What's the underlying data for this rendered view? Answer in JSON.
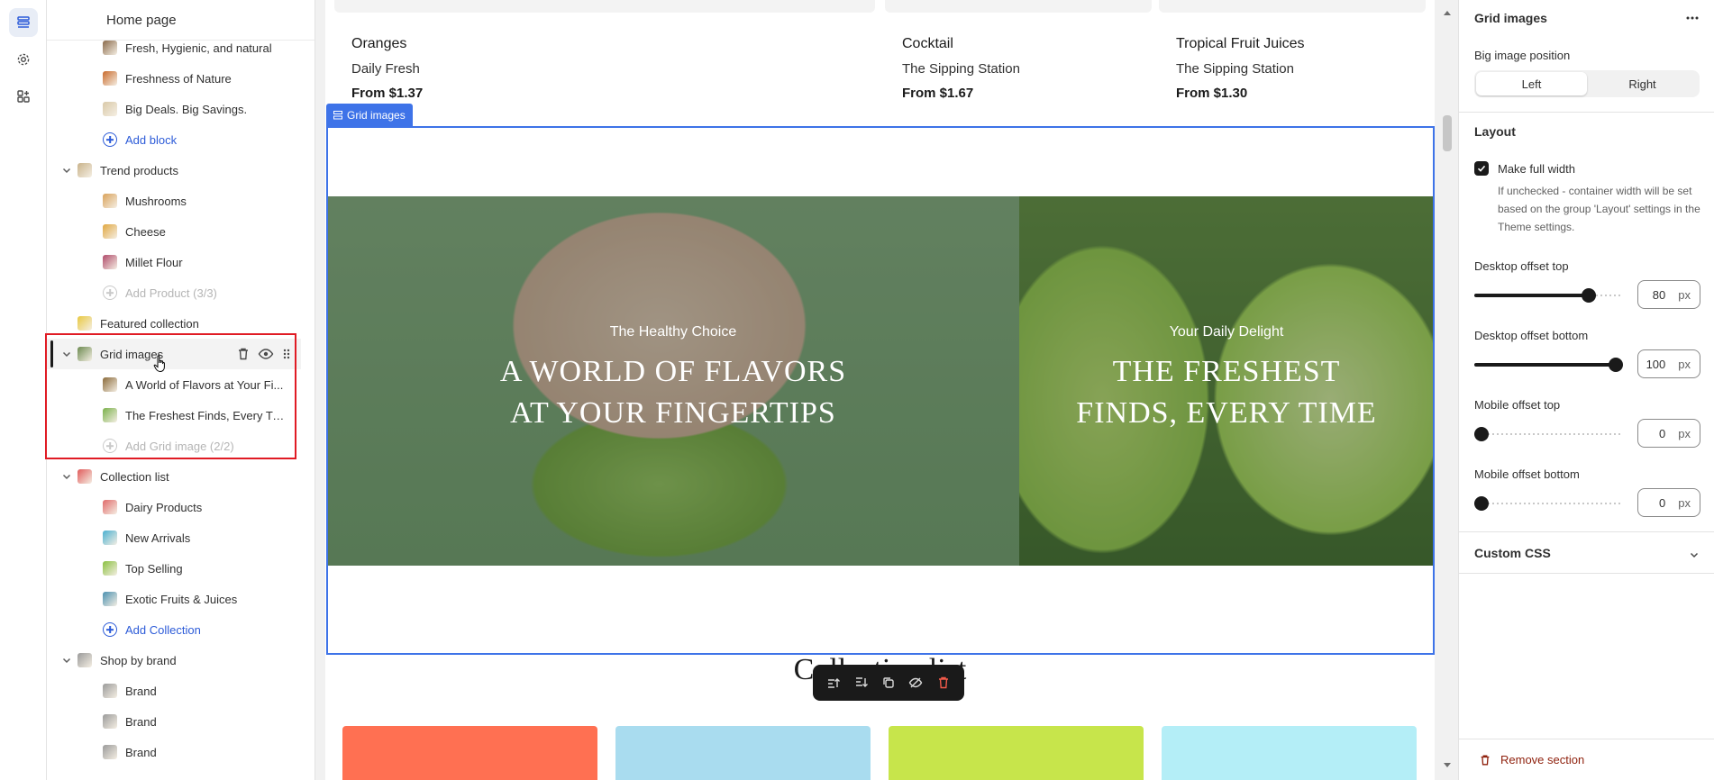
{
  "tree": {
    "title": "Home page",
    "rows": [
      {
        "label": "Fresh, Hygienic, and natural",
        "type": "child"
      },
      {
        "label": "Freshness of Nature",
        "type": "child"
      },
      {
        "label": "Big Deals. Big Savings.",
        "type": "child"
      },
      {
        "label": "Add block",
        "type": "add"
      },
      {
        "label": "Trend products",
        "type": "section"
      },
      {
        "label": "Mushrooms",
        "type": "child"
      },
      {
        "label": "Cheese",
        "type": "child"
      },
      {
        "label": "Millet Flour",
        "type": "child"
      },
      {
        "label": "Add Product (3/3)",
        "type": "add-disabled"
      },
      {
        "label": "Featured collection",
        "type": "section-nochev"
      },
      {
        "label": "Grid images",
        "type": "section-selected"
      },
      {
        "label": "A World of Flavors at Your Fi...",
        "type": "child"
      },
      {
        "label": "The Freshest Finds, Every Time",
        "type": "child"
      },
      {
        "label": "Add Grid image (2/2)",
        "type": "add-disabled"
      },
      {
        "label": "Collection list",
        "type": "section"
      },
      {
        "label": "Dairy Products",
        "type": "child"
      },
      {
        "label": "New Arrivals",
        "type": "child"
      },
      {
        "label": "Top Selling",
        "type": "child"
      },
      {
        "label": "Exotic Fruits & Juices",
        "type": "child"
      },
      {
        "label": "Add Collection",
        "type": "add"
      },
      {
        "label": "Shop by brand",
        "type": "section"
      },
      {
        "label": "Brand",
        "type": "child"
      },
      {
        "label": "Brand",
        "type": "child"
      },
      {
        "label": "Brand",
        "type": "child"
      }
    ]
  },
  "preview": {
    "products": [
      {
        "name": "Oranges",
        "vendor": "Daily Fresh",
        "price": "From $1.37"
      },
      {
        "name": "Cocktail",
        "vendor": "The Sipping Station",
        "price": "From $1.67"
      },
      {
        "name": "Tropical Fruit Juices",
        "vendor": "The Sipping Station",
        "price": "From $1.30"
      }
    ],
    "grid_tag": "Grid images",
    "left_image": {
      "subtitle": "The Healthy Choice",
      "heading_line1": "A WORLD OF FLAVORS",
      "heading_line2": "AT YOUR FINGERTIPS"
    },
    "right_image": {
      "subtitle": "Your Daily Delight",
      "heading_line1": "THE FRESHEST",
      "heading_line2": "FINDS, EVERY TIME"
    },
    "collection_title": "Collection list",
    "tile_colors": [
      "#ff7052",
      "#a9dcef",
      "#c7e54b",
      "#b4eef7"
    ]
  },
  "settings": {
    "title": "Grid images",
    "big_image_position_label": "Big image position",
    "options": {
      "left": "Left",
      "right": "Right"
    },
    "selected_option": "Left",
    "layout_heading": "Layout",
    "full_width_label": "Make full width",
    "full_width_checked": true,
    "full_width_hint": "If unchecked - container width will be set based on the group 'Layout' settings in the Theme settings.",
    "desktop_top": {
      "label": "Desktop offset top",
      "value": "80",
      "unit": "px",
      "fraction": 0.8
    },
    "desktop_bottom": {
      "label": "Desktop offset bottom",
      "value": "100",
      "unit": "px",
      "fraction": 1.0
    },
    "mobile_top": {
      "label": "Mobile offset top",
      "value": "0",
      "unit": "px",
      "fraction": 0
    },
    "mobile_bottom": {
      "label": "Mobile offset bottom",
      "value": "0",
      "unit": "px",
      "fraction": 0
    },
    "custom_css_label": "Custom CSS",
    "remove_label": "Remove section"
  }
}
